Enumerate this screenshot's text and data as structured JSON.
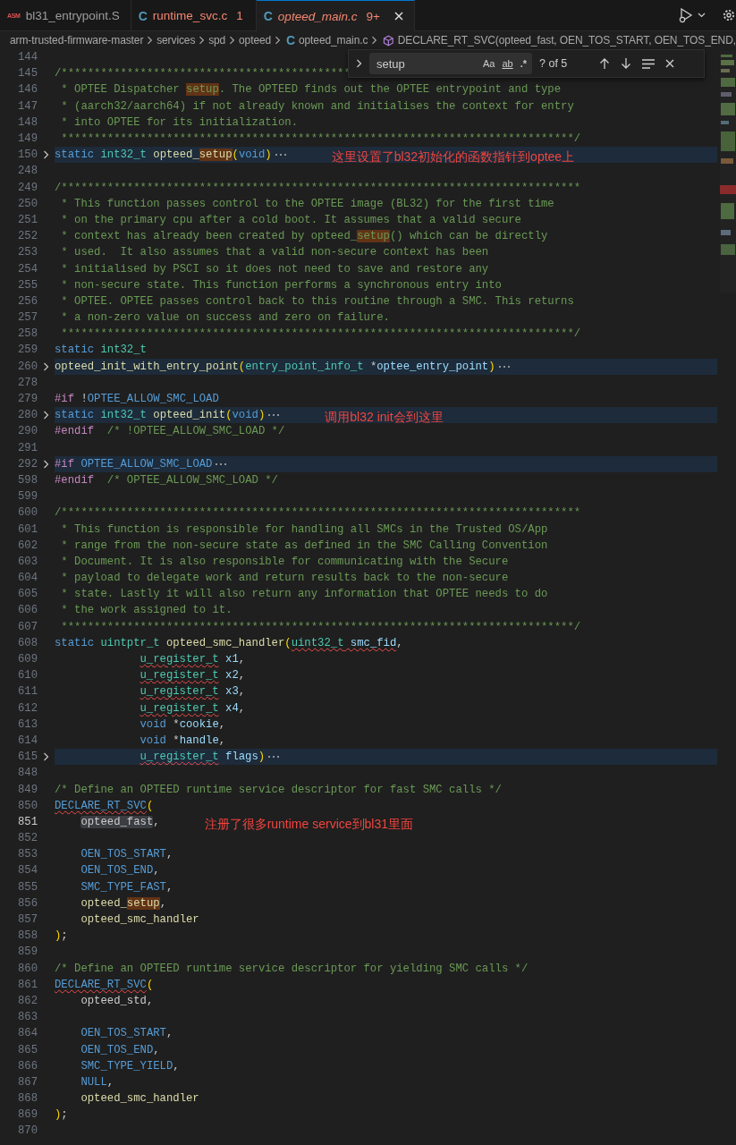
{
  "tabs": [
    {
      "icon": "ASM",
      "kind": "asm",
      "label": "bl31_entrypoint.S",
      "has_errors": false,
      "preview": false,
      "selected": false
    },
    {
      "icon": "C",
      "kind": "c",
      "label": "runtime_svc.c",
      "problems": "1",
      "has_errors": true,
      "preview": false,
      "selected": false
    },
    {
      "icon": "C",
      "kind": "c",
      "label": "opteed_main.c",
      "problems": "9+",
      "has_errors": true,
      "preview": true,
      "selected": true
    }
  ],
  "breadcrumbs": [
    {
      "kind": "folder",
      "label": "arm-trusted-firmware-master"
    },
    {
      "kind": "folder",
      "label": "services"
    },
    {
      "kind": "folder",
      "label": "spd"
    },
    {
      "kind": "folder",
      "label": "opteed"
    },
    {
      "kind": "file",
      "icon": "C",
      "label": "opteed_main.c"
    },
    {
      "kind": "symbol",
      "label": "DECLARE_RT_SVC(opteed_fast, OEN_TOS_START, OEN_TOS_END,"
    }
  ],
  "find": {
    "value": "setup",
    "options": [
      "Aa",
      "ab",
      ".*"
    ],
    "result": "? of 5"
  },
  "lines": [
    {
      "n": "144",
      "folded": false,
      "current": false
    },
    {
      "n": "145",
      "folded": false,
      "current": false,
      "segments": [
        {
          "text": "/********************************************",
          "kind": "comment"
        }
      ]
    },
    {
      "n": "146",
      "folded": false,
      "current": false,
      "segments": [
        {
          "text": " * OPTEE Dispatcher ",
          "kind": "comment"
        },
        {
          "text": "setup",
          "kind": "comment",
          "find_match": true
        },
        {
          "text": ". The OPTEED finds out the OPTEE entrypoint and type",
          "kind": "comment"
        }
      ]
    },
    {
      "n": "147",
      "folded": false,
      "current": false,
      "segments": [
        {
          "text": " * (aarch32/aarch64) if not already known and initialises the context for entry",
          "kind": "comment"
        }
      ]
    },
    {
      "n": "148",
      "folded": false,
      "current": false,
      "segments": [
        {
          "text": " * into OPTEE for its initialization.",
          "kind": "comment"
        }
      ]
    },
    {
      "n": "149",
      "folded": false,
      "current": false,
      "segments": [
        {
          "text": " ******************************************************************************/",
          "kind": "comment"
        }
      ]
    },
    {
      "n": "150",
      "folded": true,
      "current": false,
      "note": "这里设置了bl32初始化的函数指针到optee上",
      "segments": [
        {
          "text": "static ",
          "kind": "kw"
        },
        {
          "text": "int32_t ",
          "kind": "type"
        },
        {
          "text": "opteed_",
          "kind": "fn"
        },
        {
          "text": "setup",
          "kind": "fn",
          "find_match": true
        },
        {
          "text": "(",
          "kind": "punct"
        },
        {
          "text": "void",
          "kind": "kw"
        },
        {
          "text": ")",
          "kind": "punct"
        }
      ]
    },
    {
      "n": "248",
      "folded": false,
      "current": false
    },
    {
      "n": "249",
      "folded": false,
      "current": false,
      "segments": [
        {
          "text": "/*******************************************************************************",
          "kind": "comment"
        }
      ]
    },
    {
      "n": "250",
      "folded": false,
      "current": false,
      "segments": [
        {
          "text": " * This function passes control to the OPTEE image (BL32) for the first time",
          "kind": "comment"
        }
      ]
    },
    {
      "n": "251",
      "folded": false,
      "current": false,
      "segments": [
        {
          "text": " * on the primary cpu after a cold boot. It assumes that a valid secure",
          "kind": "comment"
        }
      ]
    },
    {
      "n": "252",
      "folded": false,
      "current": false,
      "segments": [
        {
          "text": " * context has already been created by opteed_",
          "kind": "comment"
        },
        {
          "text": "setup",
          "kind": "comment",
          "find_match": true
        },
        {
          "text": "() which can be directly",
          "kind": "comment"
        }
      ]
    },
    {
      "n": "253",
      "folded": false,
      "current": false,
      "segments": [
        {
          "text": " * used.  It also assumes that a valid non-secure context has been",
          "kind": "comment"
        }
      ]
    },
    {
      "n": "254",
      "folded": false,
      "current": false,
      "segments": [
        {
          "text": " * initialised by PSCI so it does not need to save and restore any",
          "kind": "comment"
        }
      ]
    },
    {
      "n": "255",
      "folded": false,
      "current": false,
      "segments": [
        {
          "text": " * non-secure state. This function performs a synchronous entry into",
          "kind": "comment"
        }
      ]
    },
    {
      "n": "256",
      "folded": false,
      "current": false,
      "segments": [
        {
          "text": " * OPTEE. OPTEE passes control back to this routine through a SMC. This returns",
          "kind": "comment"
        }
      ]
    },
    {
      "n": "257",
      "folded": false,
      "current": false,
      "segments": [
        {
          "text": " * a non-zero value on success and zero on failure.",
          "kind": "comment"
        }
      ]
    },
    {
      "n": "258",
      "folded": false,
      "current": false,
      "segments": [
        {
          "text": " ******************************************************************************/",
          "kind": "comment"
        }
      ]
    },
    {
      "n": "259",
      "folded": false,
      "current": false,
      "segments": [
        {
          "text": "static ",
          "kind": "kw"
        },
        {
          "text": "int32_t",
          "kind": "type"
        }
      ]
    },
    {
      "n": "260",
      "folded": true,
      "current": false,
      "segments": [
        {
          "text": "opteed_init_with_entry_point",
          "kind": "fn"
        },
        {
          "text": "(",
          "kind": "punct"
        },
        {
          "text": "entry_point_info_t ",
          "kind": "type"
        },
        {
          "text": "*",
          "kind": "text"
        },
        {
          "text": "optee_entry_point",
          "kind": "param"
        },
        {
          "text": ")",
          "kind": "punct"
        }
      ]
    },
    {
      "n": "278",
      "folded": false,
      "current": false
    },
    {
      "n": "279",
      "folded": false,
      "current": false,
      "segments": [
        {
          "text": "#if ",
          "kind": "pre"
        },
        {
          "text": "!",
          "kind": "text"
        },
        {
          "text": "OPTEE_ALLOW_SMC_LOAD",
          "kind": "macro"
        }
      ]
    },
    {
      "n": "280",
      "folded": true,
      "current": false,
      "note": "调用bl32 init会到这里",
      "segments": [
        {
          "text": "static ",
          "kind": "kw"
        },
        {
          "text": "int32_t ",
          "kind": "type"
        },
        {
          "text": "opteed_init",
          "kind": "fn"
        },
        {
          "text": "(",
          "kind": "punct"
        },
        {
          "text": "void",
          "kind": "kw"
        },
        {
          "text": ")",
          "kind": "punct"
        }
      ]
    },
    {
      "n": "290",
      "folded": false,
      "current": false,
      "segments": [
        {
          "text": "#endif",
          "kind": "pre"
        },
        {
          "text": "  /* !OPTEE_ALLOW_SMC_LOAD */",
          "kind": "comment"
        }
      ]
    },
    {
      "n": "291",
      "folded": false,
      "current": false
    },
    {
      "n": "292",
      "folded": true,
      "current": false,
      "segments": [
        {
          "text": "#if ",
          "kind": "pre"
        },
        {
          "text": "OPTEE_ALLOW_SMC_LOAD",
          "kind": "macro"
        }
      ]
    },
    {
      "n": "598",
      "folded": false,
      "current": false,
      "segments": [
        {
          "text": "#endif",
          "kind": "pre"
        },
        {
          "text": "  /* OPTEE_ALLOW_SMC_LOAD */",
          "kind": "comment"
        }
      ]
    },
    {
      "n": "599",
      "folded": false,
      "current": false
    },
    {
      "n": "600",
      "folded": false,
      "current": false,
      "segments": [
        {
          "text": "/*******************************************************************************",
          "kind": "comment"
        }
      ]
    },
    {
      "n": "601",
      "folded": false,
      "current": false,
      "segments": [
        {
          "text": " * This function is responsible for handling all SMCs in the Trusted OS/App",
          "kind": "comment"
        }
      ]
    },
    {
      "n": "602",
      "folded": false,
      "current": false,
      "segments": [
        {
          "text": " * range from the non-secure state as defined in the SMC Calling Convention",
          "kind": "comment"
        }
      ]
    },
    {
      "n": "603",
      "folded": false,
      "current": false,
      "segments": [
        {
          "text": " * Document. It is also responsible for communicating with the Secure",
          "kind": "comment"
        }
      ]
    },
    {
      "n": "604",
      "folded": false,
      "current": false,
      "segments": [
        {
          "text": " * payload to delegate work and return results back to the non-secure",
          "kind": "comment"
        }
      ]
    },
    {
      "n": "605",
      "folded": false,
      "current": false,
      "segments": [
        {
          "text": " * state. Lastly it will also return any information that OPTEE needs to do",
          "kind": "comment"
        }
      ]
    },
    {
      "n": "606",
      "folded": false,
      "current": false,
      "segments": [
        {
          "text": " * the work assigned to it.",
          "kind": "comment"
        }
      ]
    },
    {
      "n": "607",
      "folded": false,
      "current": false,
      "segments": [
        {
          "text": " ******************************************************************************/",
          "kind": "comment"
        }
      ]
    },
    {
      "n": "608",
      "folded": false,
      "current": false,
      "segments": [
        {
          "text": "static ",
          "kind": "kw"
        },
        {
          "text": "uintptr_t ",
          "kind": "type"
        },
        {
          "text": "opteed_smc_handler",
          "kind": "fn"
        },
        {
          "text": "(",
          "kind": "punct"
        },
        {
          "text": "uint32_t",
          "kind": "type",
          "squiggle": true
        },
        {
          "text": " smc_fid",
          "kind": "param",
          "squiggle": true
        },
        {
          "text": ",",
          "kind": "text"
        }
      ]
    },
    {
      "n": "609",
      "folded": false,
      "current": false,
      "kind": "continuation",
      "segments": [
        {
          "text": "u_register_t",
          "kind": "type",
          "squiggle": true
        },
        {
          "text": " x1",
          "kind": "param"
        },
        {
          "text": ",",
          "kind": "text"
        }
      ]
    },
    {
      "n": "610",
      "folded": false,
      "current": false,
      "kind": "continuation",
      "segments": [
        {
          "text": "u_register_t",
          "kind": "type",
          "squiggle": true
        },
        {
          "text": " x2",
          "kind": "param"
        },
        {
          "text": ",",
          "kind": "text"
        }
      ]
    },
    {
      "n": "611",
      "folded": false,
      "current": false,
      "kind": "continuation",
      "segments": [
        {
          "text": "u_register_t",
          "kind": "type",
          "squiggle": true
        },
        {
          "text": " x3",
          "kind": "param"
        },
        {
          "text": ",",
          "kind": "text"
        }
      ]
    },
    {
      "n": "612",
      "folded": false,
      "current": false,
      "kind": "continuation",
      "segments": [
        {
          "text": "u_register_t",
          "kind": "type",
          "squiggle": true
        },
        {
          "text": " x4",
          "kind": "param"
        },
        {
          "text": ",",
          "kind": "text"
        }
      ]
    },
    {
      "n": "613",
      "folded": false,
      "current": false,
      "kind": "continuation",
      "segments": [
        {
          "text": "void ",
          "kind": "kw"
        },
        {
          "text": "*",
          "kind": "text"
        },
        {
          "text": "cookie",
          "kind": "param"
        },
        {
          "text": ",",
          "kind": "text"
        }
      ]
    },
    {
      "n": "614",
      "folded": false,
      "current": false,
      "kind": "continuation",
      "segments": [
        {
          "text": "void ",
          "kind": "kw"
        },
        {
          "text": "*",
          "kind": "text"
        },
        {
          "text": "handle",
          "kind": "param"
        },
        {
          "text": ",",
          "kind": "text"
        }
      ]
    },
    {
      "n": "615",
      "folded": true,
      "current": false,
      "kind": "continuation",
      "segments": [
        {
          "text": "u_register_t",
          "kind": "type",
          "squiggle": true
        },
        {
          "text": " flags",
          "kind": "param"
        },
        {
          "text": ")",
          "kind": "punct"
        }
      ]
    },
    {
      "n": "848",
      "folded": false,
      "current": false
    },
    {
      "n": "849",
      "folded": false,
      "current": false,
      "segments": [
        {
          "text": "/* Define an OPTEED runtime service descriptor for fast SMC calls */",
          "kind": "comment"
        }
      ]
    },
    {
      "n": "850",
      "folded": false,
      "current": false,
      "segments": [
        {
          "text": "DECLARE_RT_SVC",
          "kind": "macro",
          "squiggle": true
        },
        {
          "text": "(",
          "kind": "punct"
        }
      ]
    },
    {
      "n": "851",
      "folded": false,
      "current": true,
      "kind": "body",
      "note": "注册了很多runtime service到bl31里面",
      "segments": [
        {
          "text": "opteed_fast",
          "kind": "var",
          "word_highlight": true
        },
        {
          "text": ",",
          "kind": "text"
        }
      ]
    },
    {
      "n": "852",
      "folded": false,
      "current": false
    },
    {
      "n": "853",
      "folded": false,
      "current": false,
      "kind": "body",
      "segments": [
        {
          "text": "OEN_TOS_START",
          "kind": "macro"
        },
        {
          "text": ",",
          "kind": "text"
        }
      ]
    },
    {
      "n": "854",
      "folded": false,
      "current": false,
      "kind": "body",
      "segments": [
        {
          "text": "OEN_TOS_END",
          "kind": "macro"
        },
        {
          "text": ",",
          "kind": "text"
        }
      ]
    },
    {
      "n": "855",
      "folded": false,
      "current": false,
      "kind": "body",
      "segments": [
        {
          "text": "SMC_TYPE_FAST",
          "kind": "macro"
        },
        {
          "text": ",",
          "kind": "text"
        }
      ]
    },
    {
      "n": "856",
      "folded": false,
      "current": false,
      "kind": "body",
      "segments": [
        {
          "text": "opteed_",
          "kind": "fn"
        },
        {
          "text": "setup",
          "kind": "fn",
          "find_match": true
        },
        {
          "text": ",",
          "kind": "text"
        }
      ]
    },
    {
      "n": "857",
      "folded": false,
      "current": false,
      "kind": "body",
      "segments": [
        {
          "text": "opteed_smc_handler",
          "kind": "fn"
        }
      ]
    },
    {
      "n": "858",
      "folded": false,
      "current": false,
      "segments": [
        {
          "text": ")",
          "kind": "punct"
        },
        {
          "text": ";",
          "kind": "text"
        }
      ]
    },
    {
      "n": "859",
      "folded": false,
      "current": false
    },
    {
      "n": "860",
      "folded": false,
      "current": false,
      "segments": [
        {
          "text": "/* Define an OPTEED runtime service descriptor for yielding SMC calls */",
          "kind": "comment"
        }
      ]
    },
    {
      "n": "861",
      "folded": false,
      "current": false,
      "segments": [
        {
          "text": "DECLARE_RT_SVC",
          "kind": "macro",
          "squiggle": true
        },
        {
          "text": "(",
          "kind": "punct"
        }
      ]
    },
    {
      "n": "862",
      "folded": false,
      "current": false,
      "kind": "body",
      "segments": [
        {
          "text": "opteed_std",
          "kind": "var"
        },
        {
          "text": ",",
          "kind": "text"
        }
      ]
    },
    {
      "n": "863",
      "folded": false,
      "current": false
    },
    {
      "n": "864",
      "folded": false,
      "current": false,
      "kind": "body",
      "segments": [
        {
          "text": "OEN_TOS_START",
          "kind": "macro"
        },
        {
          "text": ",",
          "kind": "text"
        }
      ]
    },
    {
      "n": "865",
      "folded": false,
      "current": false,
      "kind": "body",
      "segments": [
        {
          "text": "OEN_TOS_END",
          "kind": "macro"
        },
        {
          "text": ",",
          "kind": "text"
        }
      ]
    },
    {
      "n": "866",
      "folded": false,
      "current": false,
      "kind": "body",
      "segments": [
        {
          "text": "SMC_TYPE_YIELD",
          "kind": "macro"
        },
        {
          "text": ",",
          "kind": "text"
        }
      ]
    },
    {
      "n": "867",
      "folded": false,
      "current": false,
      "kind": "body",
      "segments": [
        {
          "text": "NULL",
          "kind": "macro"
        },
        {
          "text": ",",
          "kind": "text"
        }
      ]
    },
    {
      "n": "868",
      "folded": false,
      "current": false,
      "kind": "body",
      "segments": [
        {
          "text": "opteed_smc_handler",
          "kind": "fn"
        }
      ]
    },
    {
      "n": "869",
      "folded": false,
      "current": false,
      "segments": [
        {
          "text": ")",
          "kind": "punct"
        },
        {
          "text": ";",
          "kind": "text"
        }
      ]
    },
    {
      "n": "870",
      "folded": false,
      "current": false
    }
  ]
}
